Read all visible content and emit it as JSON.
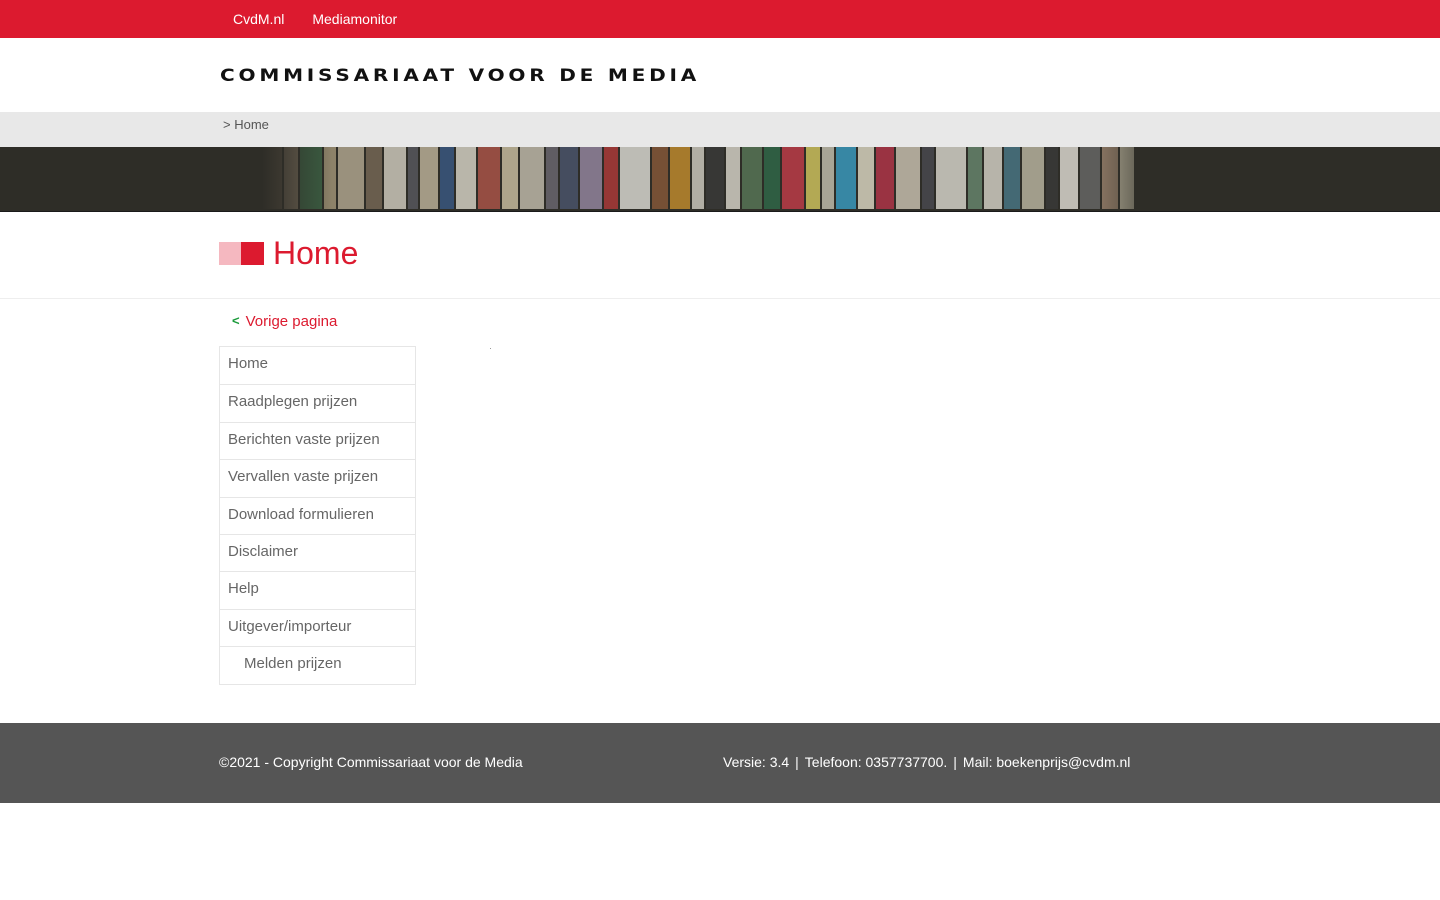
{
  "topbar": {
    "links": [
      "CvdM.nl",
      "Mediamonitor"
    ]
  },
  "header": {
    "logo_text": "COMMISSARIAAT VOOR DE MEDIA"
  },
  "breadcrumb": {
    "text": "> Home"
  },
  "page": {
    "title": "Home",
    "back_link": "Vorige pagina",
    "back_icon": "chevron-left-icon"
  },
  "sidebar": {
    "items": [
      {
        "label": "Home"
      },
      {
        "label": "Raadplegen prijzen"
      },
      {
        "label": "Berichten vaste prijzen"
      },
      {
        "label": "Vervallen vaste prijzen"
      },
      {
        "label": "Download formulieren"
      },
      {
        "label": "Disclaimer"
      },
      {
        "label": "Help"
      },
      {
        "label": "Uitgever/importeur"
      },
      {
        "label": "Melden prijzen"
      }
    ]
  },
  "footer": {
    "copyright": "©2021 - Copyright Commissariaat voor de Media",
    "version": "Versie: 3.4",
    "phone": "Telefoon: 0357737700.",
    "mail": "Mail: boekenprijs@cvdm.nl"
  },
  "colors": {
    "brand_red": "#dc1a2f",
    "brand_pale": "#f5b8c0",
    "footer_bg": "#555555",
    "crumb_bg": "#e8e8e8",
    "back_icon": "#1a9a3a"
  }
}
